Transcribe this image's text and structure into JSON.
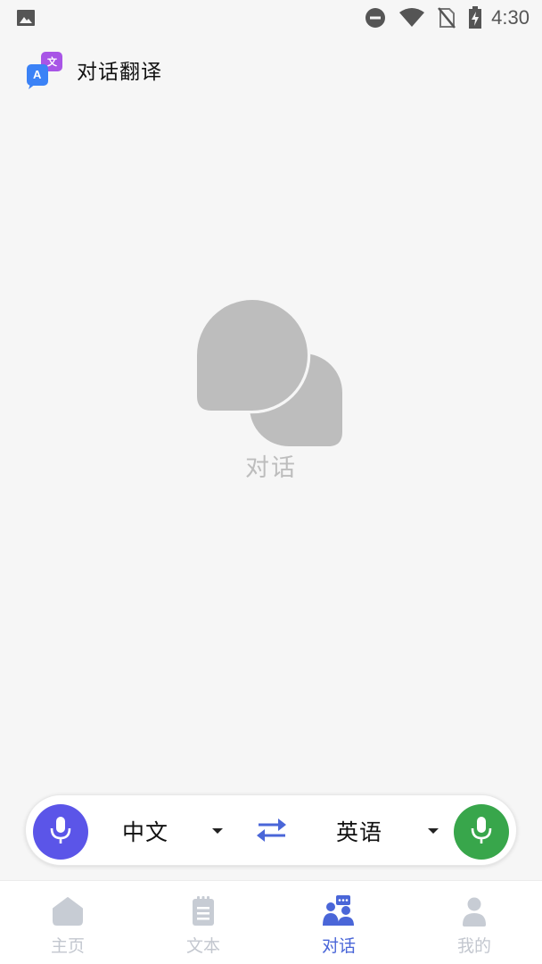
{
  "status_bar": {
    "time": "4:30",
    "icons": [
      "image-icon",
      "do-not-disturb-icon",
      "wifi-icon",
      "no-sim-icon",
      "battery-charging-icon"
    ]
  },
  "app": {
    "title": "对话翻译",
    "logo_letters": {
      "front": "A",
      "back": "文"
    }
  },
  "empty_state": {
    "icon": "chat-bubbles-icon",
    "label": "对话"
  },
  "language_bar": {
    "source_language": "中文",
    "target_language": "英语",
    "swap_icon": "swap-arrows-icon",
    "left_mic_color": "#5b55e8",
    "right_mic_color": "#38a64b"
  },
  "bottom_nav": {
    "items": [
      {
        "label": "主页",
        "icon": "home-icon",
        "active": false
      },
      {
        "label": "文本",
        "icon": "notepad-icon",
        "active": false
      },
      {
        "label": "对话",
        "icon": "conversation-icon",
        "active": true
      },
      {
        "label": "我的",
        "icon": "profile-icon",
        "active": false
      }
    ],
    "active_color": "#4a66d8",
    "inactive_color": "#c3c7cf"
  }
}
